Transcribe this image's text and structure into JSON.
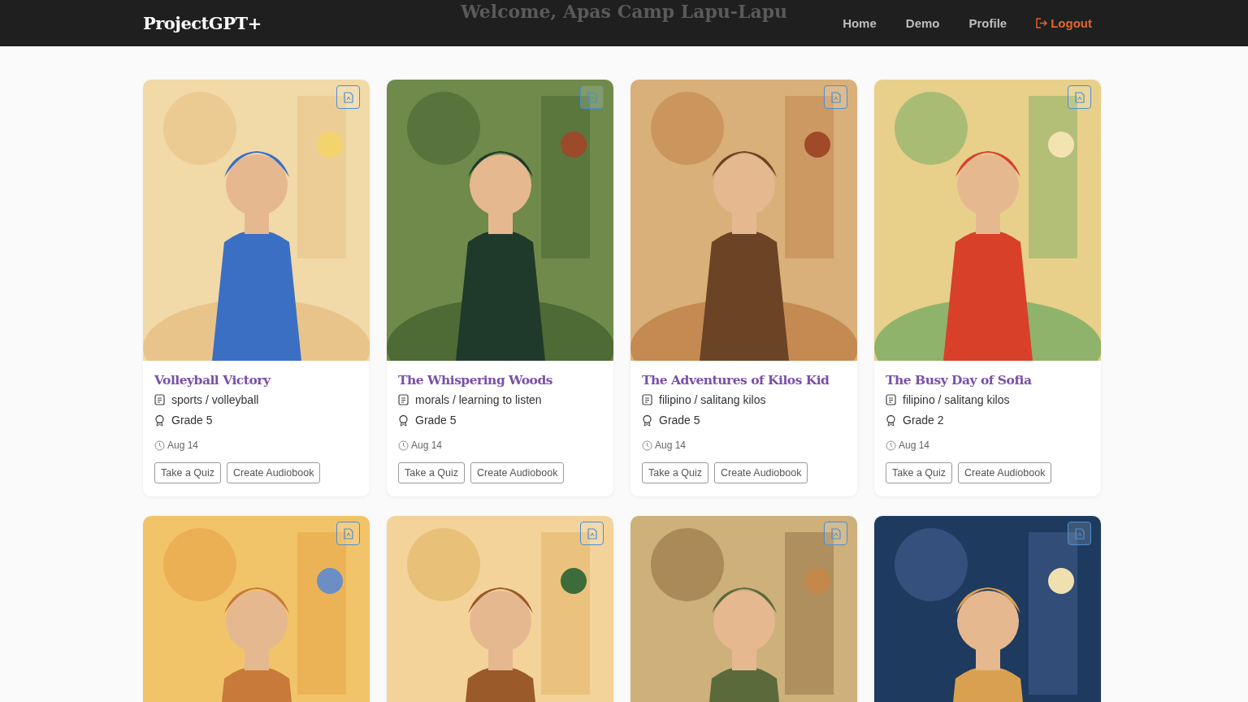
{
  "navbar": {
    "brand": "ProjectGPT+",
    "faded_heading": "Welcome, Apas Camp Lapu-Lapu",
    "links": [
      {
        "label": "Home",
        "kind": "link"
      },
      {
        "label": "Demo",
        "kind": "link"
      },
      {
        "label": "Profile",
        "kind": "link"
      },
      {
        "label": "Logout",
        "kind": "logout"
      }
    ]
  },
  "stories": [
    {
      "image": {
        "kind": "picture"
      },
      "title": "Volleyball Victory",
      "topic": "sports / volleyball",
      "grade": "Grade 5",
      "date": "Aug 14",
      "actions": [
        "Take a Quiz",
        "Create Audiobook"
      ]
    },
    {
      "image": {
        "kind": "picture"
      },
      "title": "The Whispering Woods",
      "topic": "morals / learning to listen",
      "grade": "Grade 5",
      "date": "Aug 14",
      "actions": [
        "Take a Quiz",
        "Create Audiobook"
      ]
    },
    {
      "image": {
        "kind": "picture"
      },
      "title": "The Adventures of Kilos Kid",
      "topic": "filipino / salitang kilos",
      "grade": "Grade 5",
      "date": "Aug 14",
      "actions": [
        "Take a Quiz",
        "Create Audiobook"
      ]
    },
    {
      "image": {
        "kind": "picture"
      },
      "title": "The Busy Day of Sofia",
      "topic": "filipino / salitang kilos",
      "grade": "Grade 2",
      "date": "Aug 14",
      "actions": [
        "Take a Quiz",
        "Create Audiobook"
      ]
    },
    {
      "image": {
        "kind": "picture"
      }
    },
    {
      "image": {
        "kind": "picture"
      }
    },
    {
      "image": {
        "kind": "picture"
      }
    },
    {
      "image": {
        "kind": "picture"
      }
    }
  ]
}
